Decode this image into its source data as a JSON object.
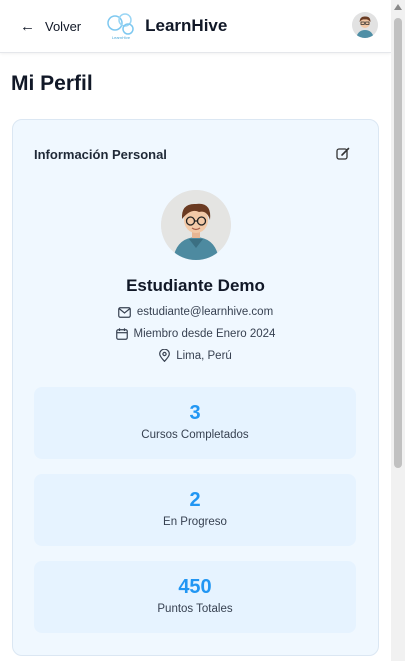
{
  "header": {
    "back_label": "Volver",
    "brand_name": "LearnHive",
    "logo_caption": "LearnHive"
  },
  "page": {
    "title": "Mi Perfil"
  },
  "profile": {
    "section_title": "Información Personal",
    "name": "Estudiante Demo",
    "email": "estudiante@learnhive.com",
    "member_since": "Miembro desde Enero 2024",
    "location": "Lima, Perú"
  },
  "stats": [
    {
      "value": "3",
      "label": "Cursos Completados"
    },
    {
      "value": "2",
      "label": "En Progreso"
    },
    {
      "value": "450",
      "label": "Puntos Totales"
    }
  ],
  "icons": {
    "back": "arrow-left-icon",
    "edit": "edit-icon",
    "email": "mail-icon",
    "calendar": "calendar-icon",
    "location": "map-pin-icon"
  },
  "colors": {
    "accent": "#2196f3",
    "card_bg": "#f0f8ff",
    "stat_bg": "#e6f3ff"
  }
}
